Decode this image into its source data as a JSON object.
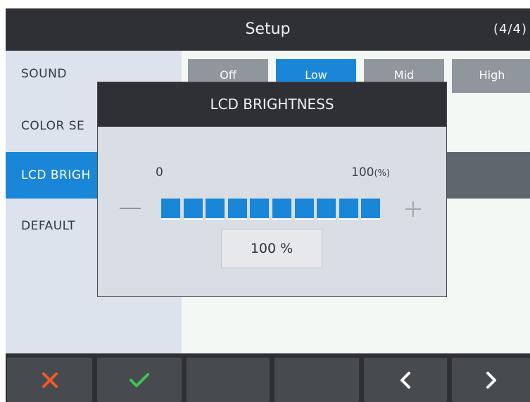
{
  "header": {
    "title": "Setup",
    "page_indicator": "(4/4)"
  },
  "sidebar": {
    "items": [
      {
        "label": "SOUND",
        "active": false
      },
      {
        "label": "COLOR SE",
        "active": false
      },
      {
        "label": "LCD BRIGH",
        "active": true
      },
      {
        "label": "DEFAULT",
        "active": false
      }
    ]
  },
  "sound_options": [
    {
      "label": "Off",
      "selected": false
    },
    {
      "label": "Low",
      "selected": true
    },
    {
      "label": "Mid",
      "selected": false
    },
    {
      "label": "High",
      "selected": false
    }
  ],
  "dialog": {
    "title": "LCD BRIGHTNESS",
    "scale_min": "0",
    "scale_max": "100",
    "scale_unit": "(%)",
    "level_segments_total": 10,
    "level_segments_filled": 10,
    "value_text": "100 %",
    "minus_icon": "minus-icon",
    "plus_icon": "plus-icon"
  },
  "toolbar": {
    "buttons": [
      "close-icon",
      "check-icon",
      "blank",
      "blank",
      "chevron-left-icon",
      "chevron-right-icon"
    ]
  },
  "colors": {
    "accent": "#1a86d8",
    "dark": "#2e3035",
    "cancel": "#f05a28",
    "confirm": "#3ec44f"
  }
}
